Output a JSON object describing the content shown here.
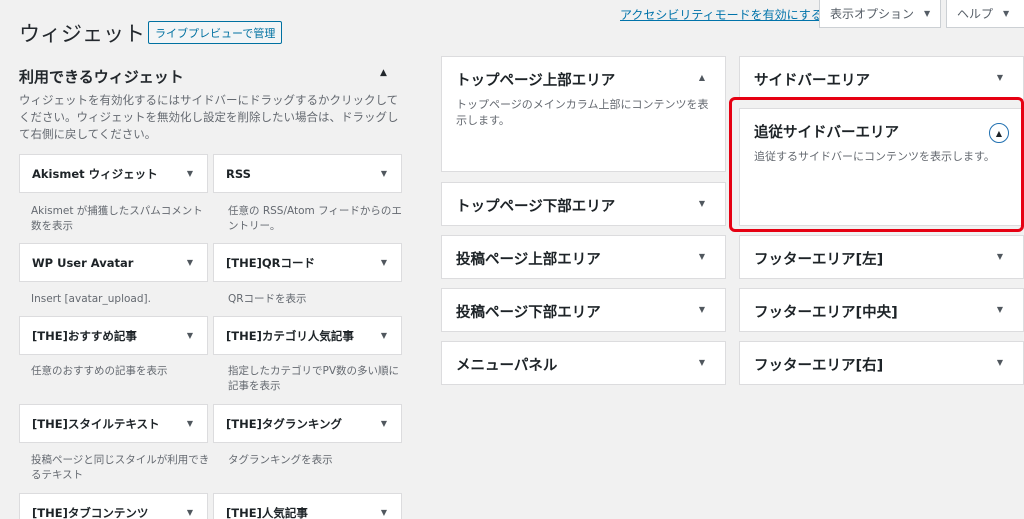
{
  "header": {
    "title": "ウィジェット",
    "manage_button": "ライブプレビューで管理",
    "a11y_link": "アクセシビリティモードを有効にする",
    "screen_options": "表示オプション",
    "help": "ヘルプ"
  },
  "available": {
    "title": "利用できるウィジェット",
    "description": "ウィジェットを有効化するにはサイドバーにドラッグするかクリックしてください。ウィジェットを無効化し設定を削除したい場合は、ドラッグして右側に戻してください。",
    "widgets": [
      {
        "name": "Akismet ウィジェット",
        "desc": "Akismet が捕獲したスパムコメント数を表示"
      },
      {
        "name": "RSS",
        "desc": "任意の RSS/Atom フィードからのエントリー。"
      },
      {
        "name": "WP User Avatar",
        "desc": "Insert [avatar_upload]."
      },
      {
        "name": "[THE]QRコード",
        "desc": "QRコードを表示"
      },
      {
        "name": "[THE]おすすめ記事",
        "desc": "任意のおすすめの記事を表示"
      },
      {
        "name": "[THE]カテゴリ人気記事",
        "desc": "指定したカテゴリでPV数の多い順に記事を表示"
      },
      {
        "name": "[THE]スタイルテキスト",
        "desc": "投稿ページと同じスタイルが利用できるテキスト"
      },
      {
        "name": "[THE]タグランキング",
        "desc": "タグランキングを表示"
      },
      {
        "name": "[THE]タブコンテンツ",
        "desc": ""
      },
      {
        "name": "[THE]人気記事",
        "desc": ""
      }
    ]
  },
  "areas": {
    "top_upper": {
      "title": "トップページ上部エリア",
      "desc": "トップページのメインカラム上部にコンテンツを表示します。"
    },
    "top_lower": {
      "title": "トップページ下部エリア"
    },
    "post_upper": {
      "title": "投稿ページ上部エリア"
    },
    "post_lower": {
      "title": "投稿ページ下部エリア"
    },
    "menu_panel": {
      "title": "メニューパネル"
    },
    "sidebar": {
      "title": "サイドバーエリア"
    },
    "follow_sidebar": {
      "title": "追従サイドバーエリア",
      "desc": "追従するサイドバーにコンテンツを表示します。"
    },
    "footer_left": {
      "title": "フッターエリア[左]"
    },
    "footer_center": {
      "title": "フッターエリア[中央]"
    },
    "footer_right": {
      "title": "フッターエリア[右]"
    }
  },
  "colors": {
    "accent": "#0073aa",
    "highlight": "#e60012"
  }
}
